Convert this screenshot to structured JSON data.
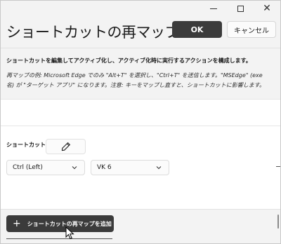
{
  "window": {
    "title": "ショートカットの再マップ",
    "caption": {
      "minimize_icon": "minimize-icon",
      "maximize_icon": "maximize-icon",
      "close_glyph": "✕"
    }
  },
  "header": {
    "ok_label": "OK",
    "cancel_label": "キャンセル"
  },
  "description": "ショートカットを編集してアクティブ化し、アクティブ化時に実行するアクションを構成します。",
  "example_lines": [
    "再マップの例: Microsoft Edge でのみ \"Alt+T\" を選択し、\"Ctrl+T\" を送信します。\"MSEdge\" (exe",
    "名) が \"ターゲット アプリ\" になります。注意: キーをマップし直すと、ショートカットに影響します。"
  ],
  "shortcut_row": {
    "label": "ショートカット:",
    "edit_icon": "pencil-icon",
    "key_dropdown_value": "Ctrl (Left)",
    "second_dropdown_value": "VK 6"
  },
  "footer": {
    "add_plus": "+",
    "add_label": "ショートカットの再マップを追加"
  },
  "colors": {
    "primary_button": "#3b3b3b",
    "window_bg": "#f3f3f3",
    "panel_bg": "#ffffff"
  }
}
